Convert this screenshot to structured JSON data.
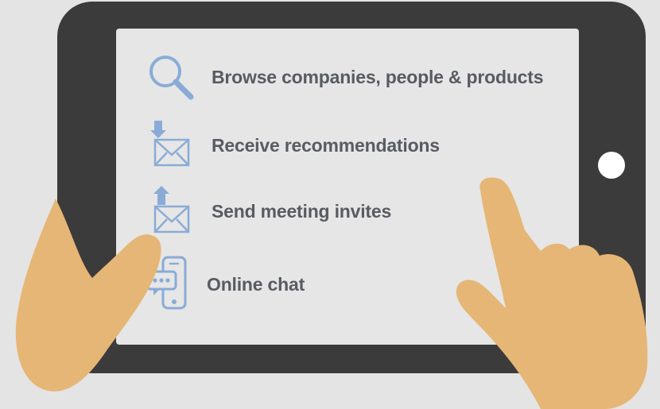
{
  "colors": {
    "background": "#e4e4e4",
    "tablet": "#3b3b3b",
    "screen": "#e6e6e6",
    "icon": "#8aabd6",
    "text": "#585b61",
    "skin": "#e6b676"
  },
  "features": [
    {
      "icon": "search-icon",
      "label": "Browse companies, people & products"
    },
    {
      "icon": "mail-download-icon",
      "label": "Receive recommendations"
    },
    {
      "icon": "mail-upload-icon",
      "label": "Send meeting invites"
    },
    {
      "icon": "chat-phone-icon",
      "label": "Online chat"
    }
  ]
}
